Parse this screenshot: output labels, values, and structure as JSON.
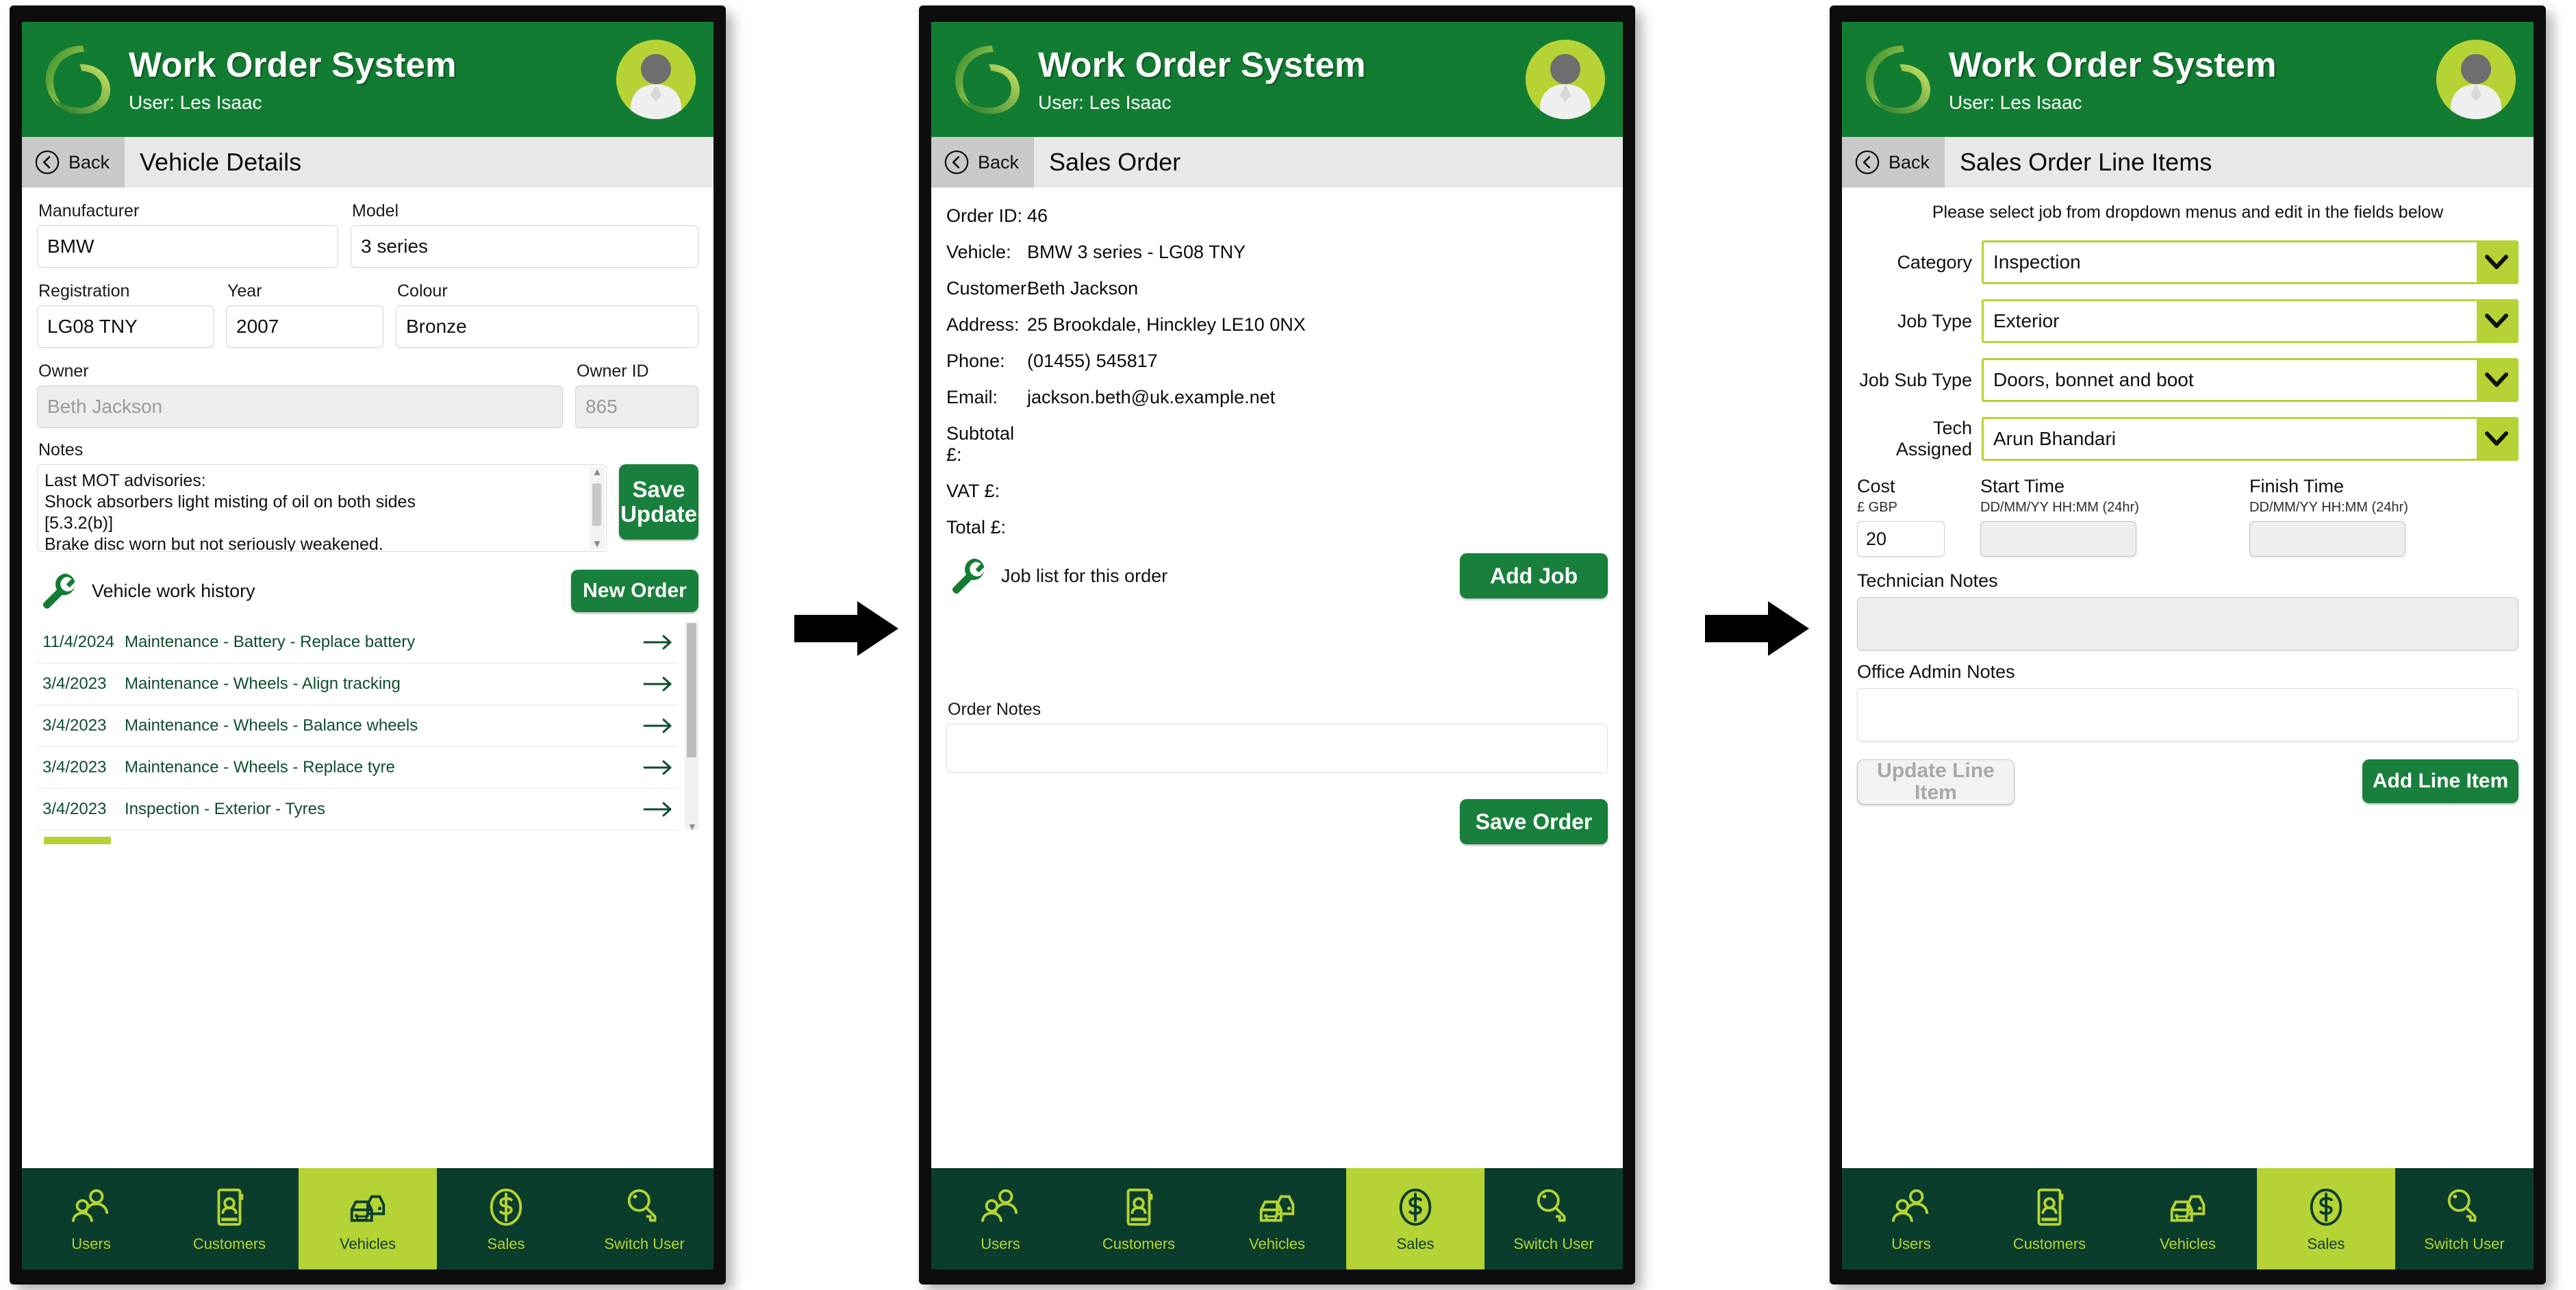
{
  "app": {
    "title": "Work Order System",
    "user_line": "User: Les Isaac",
    "logo_icon": "swirl-logo-icon",
    "avatar_icon": "user-avatar-photo"
  },
  "nav": {
    "items": [
      {
        "label": "Users",
        "icon": "users-icon",
        "active": false
      },
      {
        "label": "Customers",
        "icon": "contact-card-icon",
        "active": false
      },
      {
        "label": "Vehicles",
        "icon": "car-icon",
        "active": false
      },
      {
        "label": "Sales",
        "icon": "dollar-coin-icon",
        "active": false
      },
      {
        "label": "Switch User",
        "icon": "key-icon",
        "active": false
      }
    ],
    "active_panel1": "Vehicles",
    "active_panel2": "Sales",
    "active_panel3": "Sales"
  },
  "back_label": "Back",
  "panel1": {
    "screen_title": "Vehicle Details",
    "fields": {
      "manufacturer_label": "Manufacturer",
      "manufacturer_value": "BMW",
      "model_label": "Model",
      "model_value": "3 series",
      "registration_label": "Registration",
      "registration_value": "LG08 TNY",
      "year_label": "Year",
      "year_value": "2007",
      "colour_label": "Colour",
      "colour_value": "Bronze",
      "owner_label": "Owner",
      "owner_placeholder": "Beth Jackson",
      "owner_id_label": "Owner ID",
      "owner_id_placeholder": "865",
      "notes_label": "Notes"
    },
    "notes_lines": [
      "Last MOT advisories:",
      "Shock absorbers light misting of oil on both sides",
      "[5.3.2(b)]",
      "Brake disc worn but not seriously weakened."
    ],
    "save_update_label_1": "Save",
    "save_update_label_2": "Update",
    "work_history_title": "Vehicle work history",
    "new_order_label": "New Order",
    "history": [
      {
        "date": "11/4/2024",
        "job": "Maintenance - Battery - Replace battery"
      },
      {
        "date": "3/4/2023",
        "job": "Maintenance - Wheels - Align tracking"
      },
      {
        "date": "3/4/2023",
        "job": "Maintenance - Wheels - Balance wheels"
      },
      {
        "date": "3/4/2023",
        "job": "Maintenance - Wheels - Replace tyre"
      },
      {
        "date": "3/4/2023",
        "job": "Inspection - Exterior - Tyres"
      }
    ]
  },
  "panel2": {
    "screen_title": "Sales Order",
    "details": [
      {
        "key": "Order ID:",
        "value": "46"
      },
      {
        "key": "Vehicle:",
        "value": "BMW 3 series - LG08 TNY"
      },
      {
        "key": "Customer:",
        "value": "Beth Jackson"
      },
      {
        "key": "Address:",
        "value": "25 Brookdale, Hinckley LE10 0NX"
      },
      {
        "key": "Phone:",
        "value": "(01455) 545817"
      },
      {
        "key": "Email:",
        "value": "jackson.beth@uk.example.net"
      },
      {
        "key": "Subtotal £:",
        "value": ""
      },
      {
        "key": "VAT £:",
        "value": ""
      },
      {
        "key": "Total £:",
        "value": ""
      }
    ],
    "job_list_label": "Job list for this order",
    "add_job_label": "Add Job",
    "order_notes_label": "Order Notes",
    "order_notes_value": "",
    "save_order_label": "Save Order"
  },
  "panel3": {
    "screen_title": "Sales Order Line Items",
    "instruction": "Please select job from dropdown menus and edit in the fields below",
    "dropdowns": [
      {
        "label": "Category",
        "value": "Inspection"
      },
      {
        "label": "Job Type",
        "value": "Exterior"
      },
      {
        "label": "Job Sub Type",
        "value": "Doors, bonnet and boot"
      },
      {
        "label": "Tech Assigned",
        "value": "Arun Bhandari"
      }
    ],
    "cost_label": "Cost",
    "cost_hint": "£ GBP",
    "cost_value": "20",
    "start_label": "Start Time",
    "start_hint": "DD/MM/YY HH:MM (24hr)",
    "start_value": "",
    "finish_label": "Finish Time",
    "finish_hint": "DD/MM/YY HH:MM (24hr)",
    "finish_value": "",
    "tech_notes_label": "Technician Notes",
    "tech_notes_value": "",
    "office_notes_label": "Office Admin Notes",
    "office_notes_value": "",
    "update_line_label": "Update Line Item",
    "add_line_label": "Add Line Item"
  },
  "colors": {
    "brand_green": "#127d32",
    "dark_green": "#0b3d2c",
    "lime": "#b5d334",
    "button_green": "#18803c",
    "list_text": "#0f4d30"
  }
}
